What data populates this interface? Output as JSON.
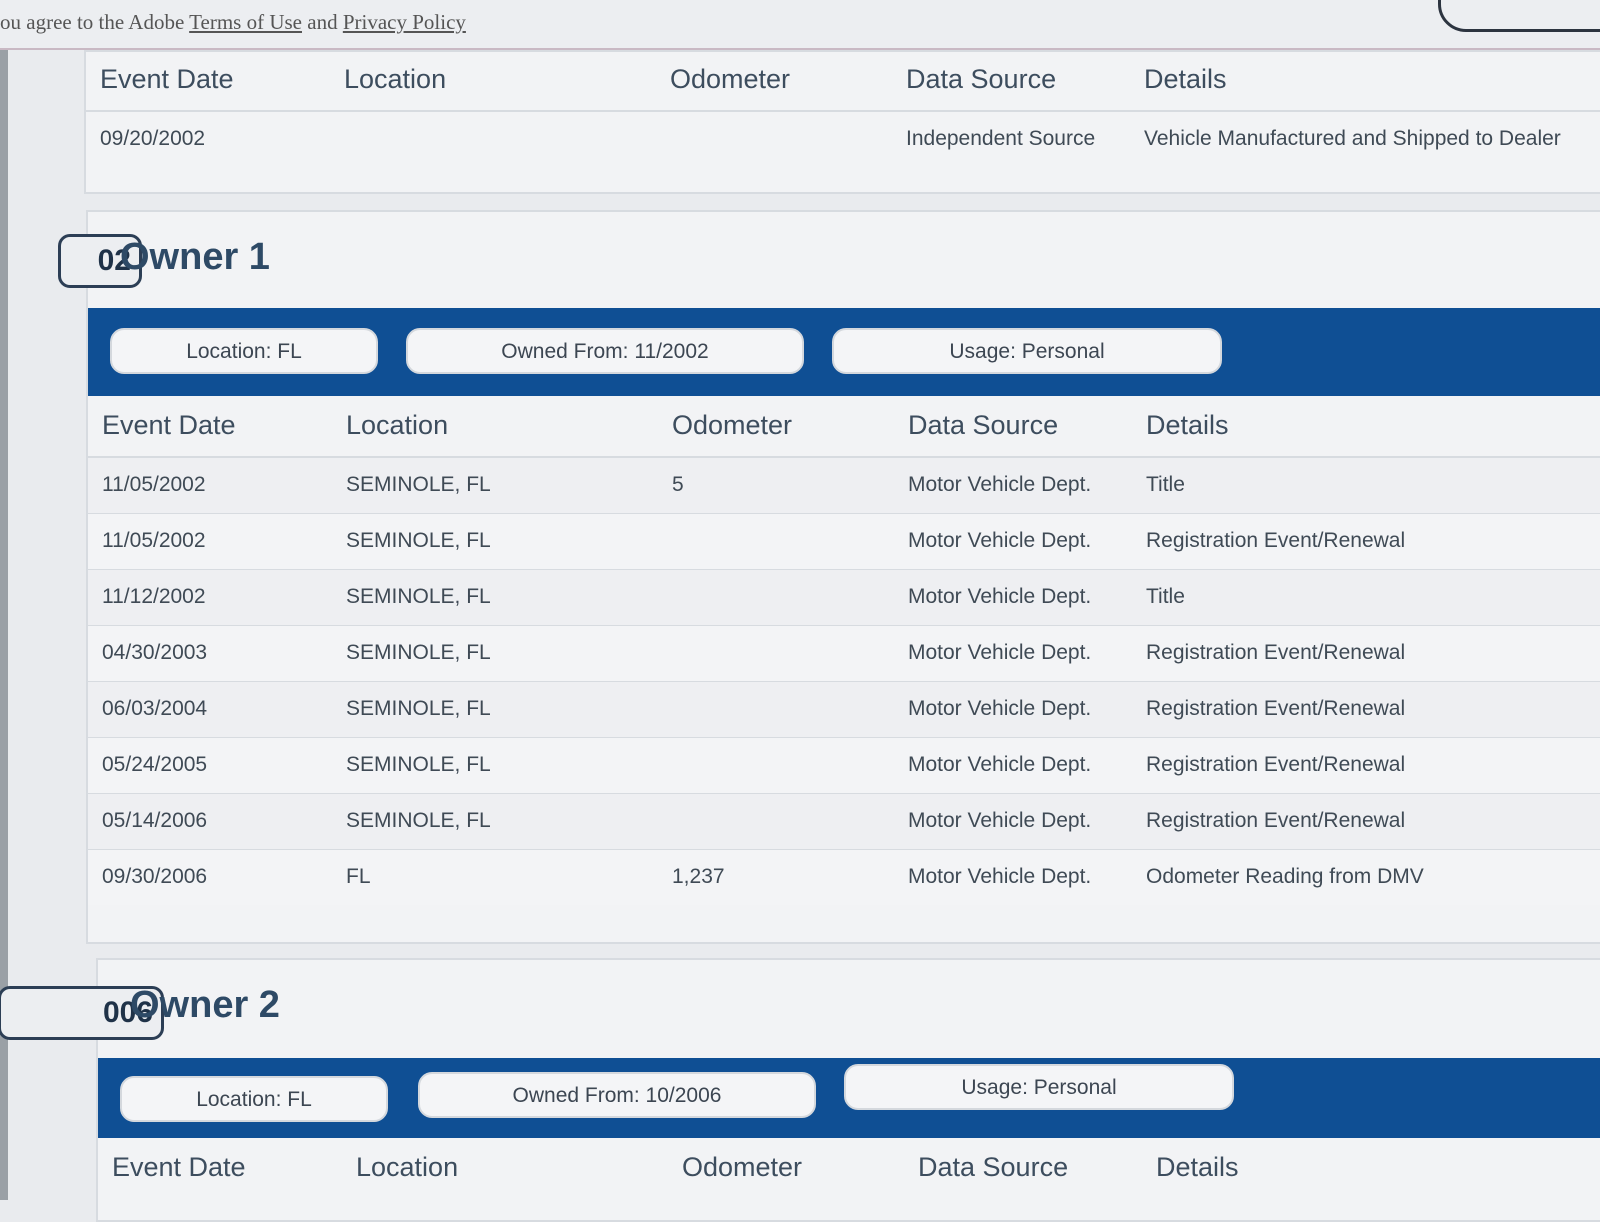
{
  "topbar": {
    "agree_prefix": "ou agree to the Adobe ",
    "terms_link": "Terms of Use",
    "and_text": " and ",
    "privacy_link": "Privacy Policy"
  },
  "columns": [
    "Event Date",
    "Location",
    "Odometer",
    "Data Source",
    "Details"
  ],
  "manufacture": {
    "rows": [
      [
        "09/20/2002",
        "",
        "",
        "Independent Source",
        "Vehicle Manufactured and Shipped to Dealer"
      ]
    ]
  },
  "owner1": {
    "year_badge": "02",
    "title": "Owner 1",
    "location": "Location: FL",
    "owned_from": "Owned From: 11/2002",
    "usage": "Usage: Personal",
    "rows": [
      [
        "11/05/2002",
        "SEMINOLE, FL",
        "5",
        "Motor Vehicle Dept.",
        "Title"
      ],
      [
        "11/05/2002",
        "SEMINOLE, FL",
        "",
        "Motor Vehicle Dept.",
        "Registration Event/Renewal"
      ],
      [
        "11/12/2002",
        "SEMINOLE, FL",
        "",
        "Motor Vehicle Dept.",
        "Title"
      ],
      [
        "04/30/2003",
        "SEMINOLE, FL",
        "",
        "Motor Vehicle Dept.",
        "Registration Event/Renewal"
      ],
      [
        "06/03/2004",
        "SEMINOLE, FL",
        "",
        "Motor Vehicle Dept.",
        "Registration Event/Renewal"
      ],
      [
        "05/24/2005",
        "SEMINOLE, FL",
        "",
        "Motor Vehicle Dept.",
        "Registration Event/Renewal"
      ],
      [
        "05/14/2006",
        "SEMINOLE, FL",
        "",
        "Motor Vehicle Dept.",
        "Registration Event/Renewal"
      ],
      [
        "09/30/2006",
        "FL",
        "1,237",
        "Motor Vehicle Dept.",
        "Odometer Reading from DMV"
      ]
    ]
  },
  "owner2": {
    "year_badge": "006",
    "title": "Owner 2",
    "location": "Location: FL",
    "owned_from": "Owned From: 10/2006",
    "usage": "Usage: Personal"
  },
  "colors": {
    "accent_blue": "#0f4f94",
    "title_blue": "#2e4a66"
  }
}
